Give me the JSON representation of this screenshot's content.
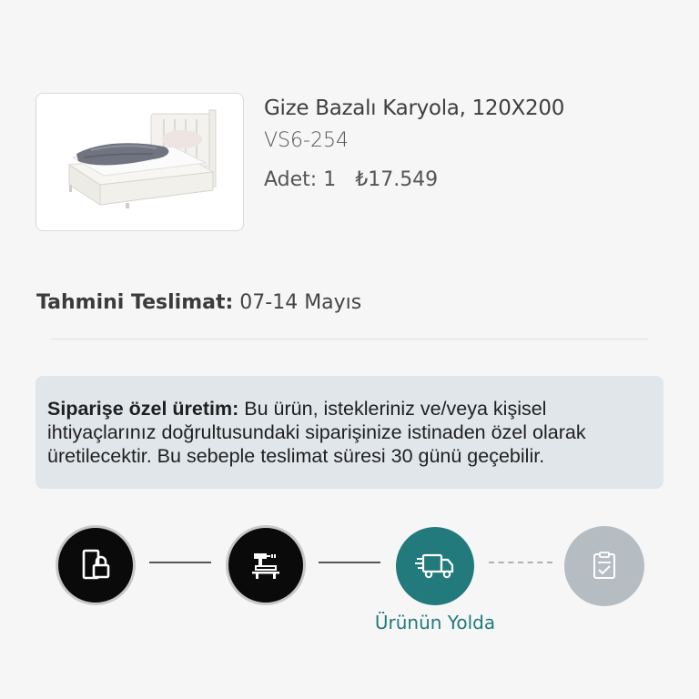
{
  "product": {
    "name": "Gize Bazalı Karyola, 120X200",
    "sku": "VS6-254",
    "quantity_label": "Adet: 1",
    "price": "₺17.549",
    "image_alt": "product-image"
  },
  "delivery": {
    "label": "Tahmini Teslimat:",
    "date": "07-14 Mayıs"
  },
  "notice": {
    "title": "Siparişe özel üretim:",
    "text": " Bu ürün, istekleriniz ve/veya kişisel ihtiyaçlarınız doğrultusundaki siparişinize istinaden özel olarak üretilecektir. Bu sebeple teslimat süresi 30 günü geçebilir."
  },
  "tracker": {
    "steps": [
      {
        "icon": "order-confirmed-icon",
        "status": "done"
      },
      {
        "icon": "production-icon",
        "status": "done"
      },
      {
        "icon": "delivery-truck-icon",
        "status": "active",
        "label": "Ürünün Yolda"
      },
      {
        "icon": "delivered-checklist-icon",
        "status": "pending"
      }
    ]
  },
  "colors": {
    "accent": "#227a7c",
    "done": "#0a0a0a",
    "pending": "#b5bdc3",
    "notice_bg": "#e1e6ea",
    "background": "#f6f6f7"
  }
}
